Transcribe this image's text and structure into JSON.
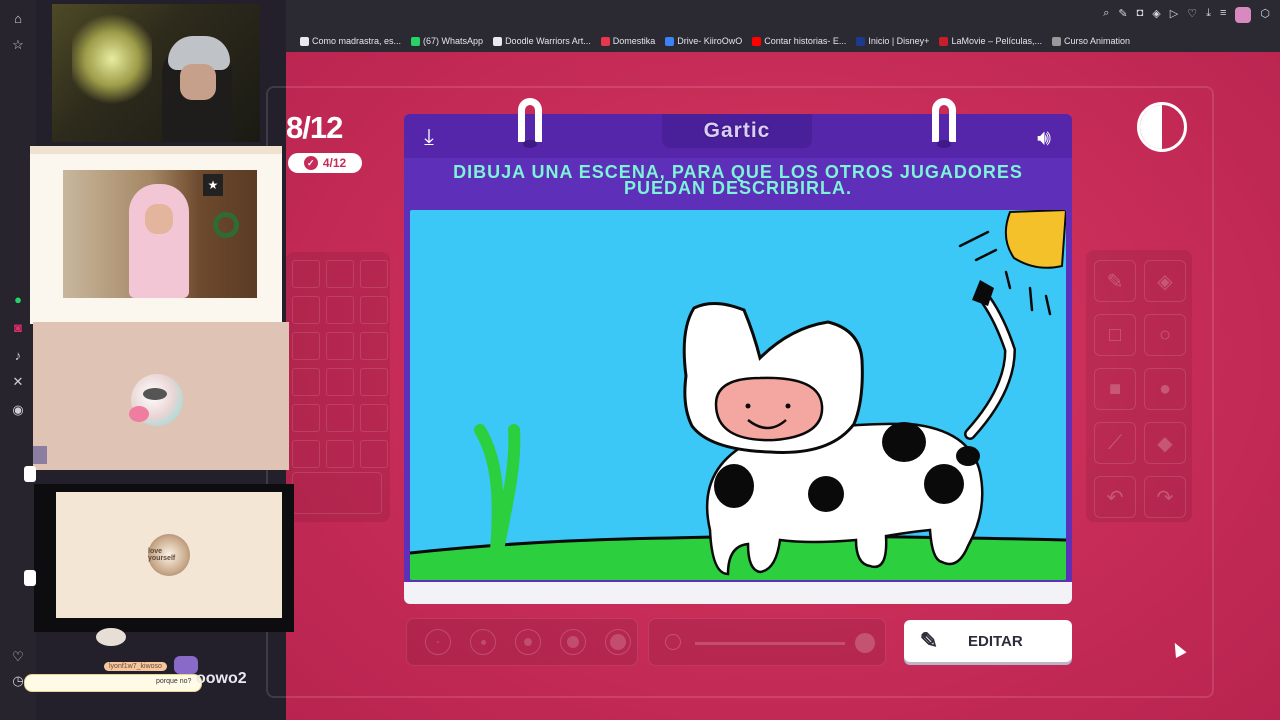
{
  "browser": {
    "bookmarks": [
      {
        "label": "Como madrastra, es...",
        "color": "#e8e8ee"
      },
      {
        "label": "(67) WhatsApp",
        "color": "#25d366"
      },
      {
        "label": "Doodle Warriors Art...",
        "color": "#e8e8ee"
      },
      {
        "label": "Domestika",
        "color": "#e8364c"
      },
      {
        "label": "Drive- KiiroOwO",
        "color": "#3b82f6"
      },
      {
        "label": "Contar historias- E...",
        "color": "#ff0000"
      },
      {
        "label": "Inicio | Disney+",
        "color": "#1d3b8c"
      },
      {
        "label": "LaMovie – Películas,...",
        "color": "#c81d2a"
      },
      {
        "label": "Curso Animation",
        "color": "#999999"
      }
    ]
  },
  "game": {
    "round_big": "8/12",
    "round_pill": "4/12",
    "logo": "Gartic",
    "prompt_line1": "DIBUJA UNA ESCENA, PARA QUE LOS OTROS JUGADORES",
    "prompt_line2": "PUEDAN DESCRIBIRLA.",
    "edit_label": "EDITAR"
  },
  "chat": {
    "user": "lyonf1w7_kiwoso",
    "message": "porque no?",
    "name_fragment": "oowo2"
  },
  "overlay": {
    "badge_text": "love yourself"
  },
  "colors": {
    "page_bg": "#c72c58",
    "board": "#5e2fb8",
    "canvas_sky": "#3bc8f6",
    "grass": "#2ccf3d",
    "prompt": "#7df3d8"
  }
}
